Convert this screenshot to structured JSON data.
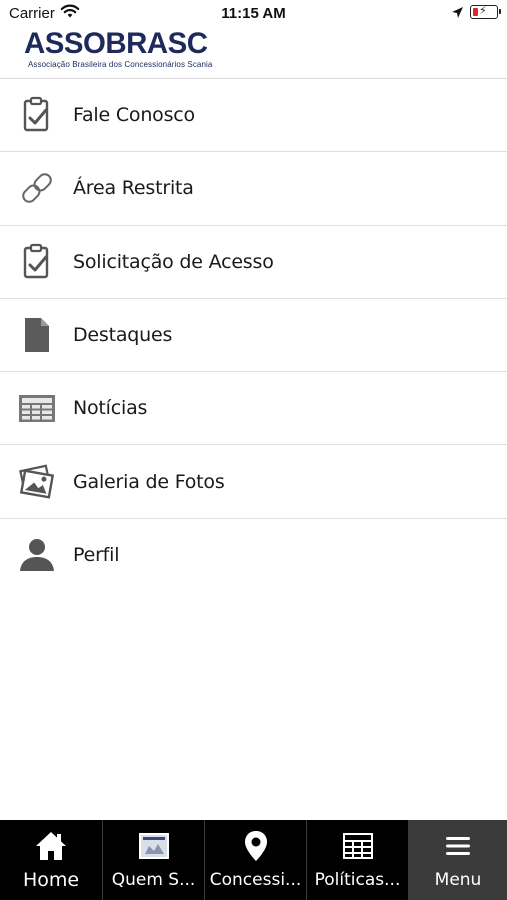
{
  "status_bar": {
    "carrier": "Carrier",
    "time": "11:15 AM",
    "icons": [
      "wifi-icon",
      "location-arrow-icon",
      "battery-charging-icon"
    ],
    "battery_level": 0.2
  },
  "header": {
    "logo_title": "ASSOBRASC",
    "logo_subtitle": "Associação Brasileira dos Concessionários Scania",
    "brand_color": "#1e2a5c"
  },
  "menu": {
    "items": [
      {
        "label": "Fale Conosco",
        "icon": "clipboard-check-icon"
      },
      {
        "label": "Área Restrita",
        "icon": "link-icon"
      },
      {
        "label": "Solicitação de Acesso",
        "icon": "clipboard-check-icon"
      },
      {
        "label": "Destaques",
        "icon": "document-icon"
      },
      {
        "label": "Notícias",
        "icon": "newspaper-icon"
      },
      {
        "label": "Galeria de Fotos",
        "icon": "photos-icon"
      },
      {
        "label": "Perfil",
        "icon": "user-icon"
      }
    ]
  },
  "tab_bar": {
    "background": "#000000",
    "selected_background": "#3b3b3b",
    "tabs": [
      {
        "label": "Home",
        "icon": "home-icon",
        "selected": false
      },
      {
        "label": "Quem S...",
        "icon": "building-image-icon",
        "selected": false
      },
      {
        "label": "Concessi...",
        "icon": "map-pin-icon",
        "selected": false
      },
      {
        "label": "Políticas...",
        "icon": "table-icon",
        "selected": false
      },
      {
        "label": "Menu",
        "icon": "hamburger-icon",
        "selected": true
      }
    ]
  }
}
